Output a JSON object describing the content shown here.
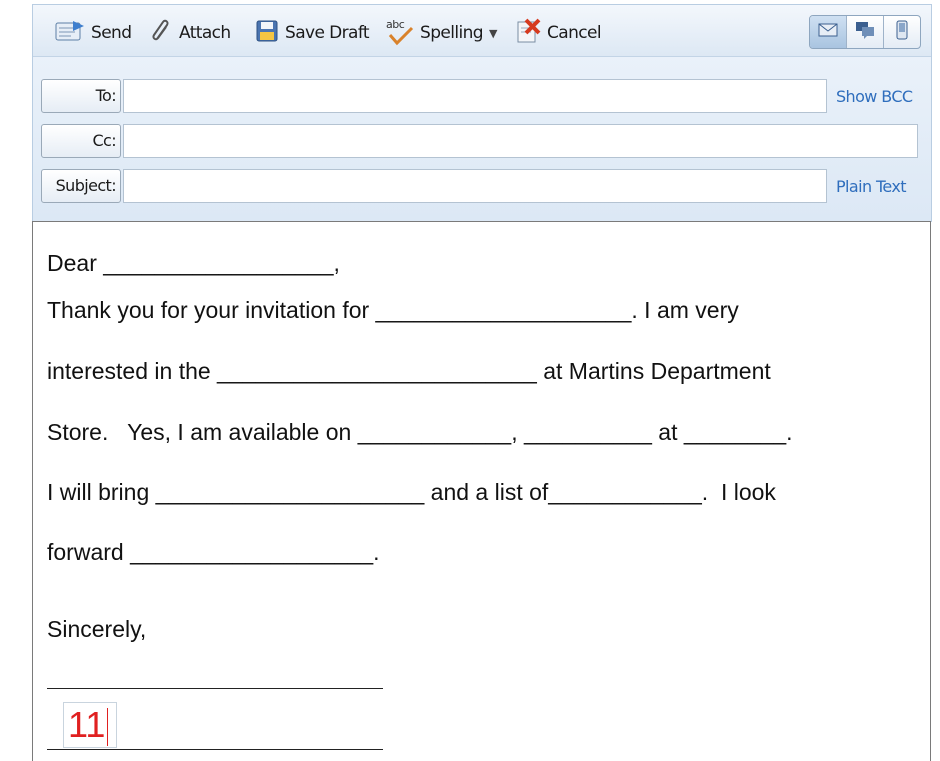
{
  "toolbar": {
    "send_label": "Send",
    "attach_label": "Attach",
    "save_draft_label": "Save Draft",
    "spelling_label": "Spelling",
    "spelling_icon_text": "abc",
    "cancel_label": "Cancel"
  },
  "fields": {
    "to_label": "To:",
    "cc_label": "Cc:",
    "subject_label": "Subject:",
    "to_value": "",
    "cc_value": "",
    "subject_value": "",
    "show_bcc_link": "Show BCC",
    "plain_text_link": "Plain Text"
  },
  "letter": {
    "lines": [
      "Dear __________________,",
      "Thank you for your invitation for ____________________. I am very",
      "interested in the _________________________ at Martins Department",
      "Store.   Yes, I am available on ____________, __________ at ________.",
      "I will bring _____________________ and a list of____________.  I look",
      "forward ___________________.",
      "Sincerely,"
    ],
    "badge_number": "11"
  },
  "colors": {
    "link": "#2f6ebd",
    "badge_text": "#e02020",
    "header_bg": "#dce8f5"
  }
}
